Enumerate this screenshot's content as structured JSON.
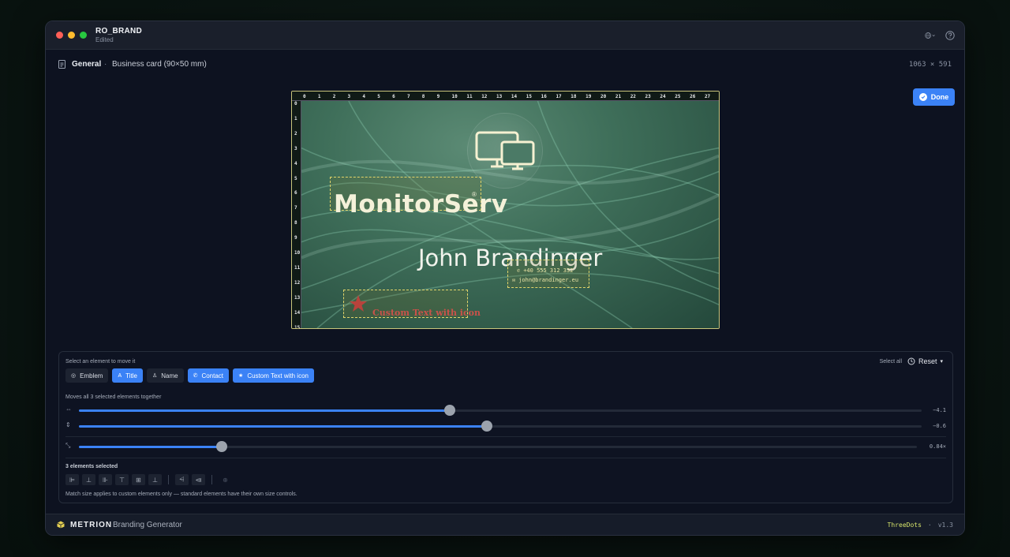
{
  "window": {
    "title": "RO_BRAND",
    "subtitle": "Edited"
  },
  "subheader": {
    "section": "General",
    "separator": "·",
    "document": "Business card (90×50 mm)",
    "dimensions": "1063 × 591"
  },
  "done_label": "Done",
  "ruler": {
    "top": [
      "0",
      "1",
      "2",
      "3",
      "4",
      "5",
      "6",
      "7",
      "8",
      "9",
      "10",
      "11",
      "12",
      "13",
      "14",
      "15",
      "16",
      "17",
      "18",
      "19",
      "20",
      "21",
      "22",
      "23",
      "24",
      "25",
      "26",
      "27"
    ],
    "left": [
      "0",
      "1",
      "2",
      "3",
      "4",
      "5",
      "6",
      "7",
      "8",
      "9",
      "10",
      "11",
      "12",
      "13",
      "14",
      "15"
    ]
  },
  "card": {
    "title": "MonitorServ",
    "registered": "®",
    "name": "John Brandinger",
    "phone": "+40 555 312 332",
    "email": "john@brandinger.eu",
    "custom_text": "Custom Text with icon"
  },
  "controls": {
    "select_prompt": "Select an element to move it",
    "select_all": "Select all",
    "reset": "Reset",
    "chips": [
      {
        "label": "Emblem",
        "active": false
      },
      {
        "label": "Title",
        "active": true
      },
      {
        "label": "Name",
        "active": false
      },
      {
        "label": "Contact",
        "active": true
      },
      {
        "label": "Custom Text with icon",
        "active": true
      }
    ],
    "moves_note": "Moves all 3 selected elements together",
    "sliders": [
      {
        "icon": "horizontal-move-icon",
        "value": "−4.1",
        "fraction": 0.44
      },
      {
        "icon": "vertical-move-icon",
        "value": "−0.6",
        "fraction": 0.484
      },
      {
        "icon": "scale-icon",
        "value": "0.84×",
        "fraction": 0.17
      }
    ],
    "selected_count": "3 elements selected",
    "match_note": "Match size applies to custom elements only — standard elements have their own size controls."
  },
  "footer": {
    "brand": "METRION",
    "product": "Branding Generator",
    "company": "ThreeDots",
    "separator": "·",
    "version": "v1.3"
  },
  "colors": {
    "accent": "#3b82f6",
    "card_green": "#3f6f5a",
    "selection": "#e1d46a",
    "custom_text": "#c9524a"
  }
}
